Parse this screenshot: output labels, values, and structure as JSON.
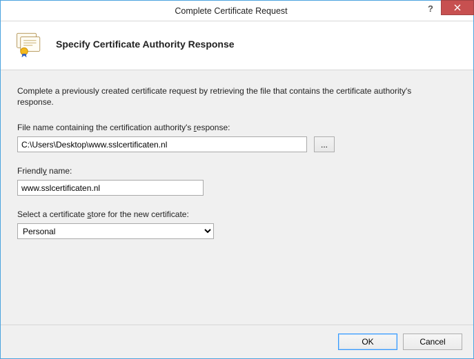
{
  "window": {
    "title": "Complete Certificate Request"
  },
  "header": {
    "title": "Specify Certificate Authority Response"
  },
  "body": {
    "description": "Complete a previously created certificate request by retrieving the file that contains the certificate authority's response.",
    "file_label_pre": "File name containing the certification authority's ",
    "file_label_accel": "r",
    "file_label_post": "esponse:",
    "file_value": "C:\\Users\\Desktop\\www.sslcertificaten.nl",
    "browse_label": "...",
    "friendly_label_pre": "Friendl",
    "friendly_label_accel": "y",
    "friendly_label_post": " name:",
    "friendly_value": "www.sslcertificaten.nl",
    "store_label_pre": "Select a certificate ",
    "store_label_accel": "s",
    "store_label_post": "tore for the new certificate:",
    "store_value": "Personal"
  },
  "footer": {
    "ok": "OK",
    "cancel": "Cancel"
  }
}
